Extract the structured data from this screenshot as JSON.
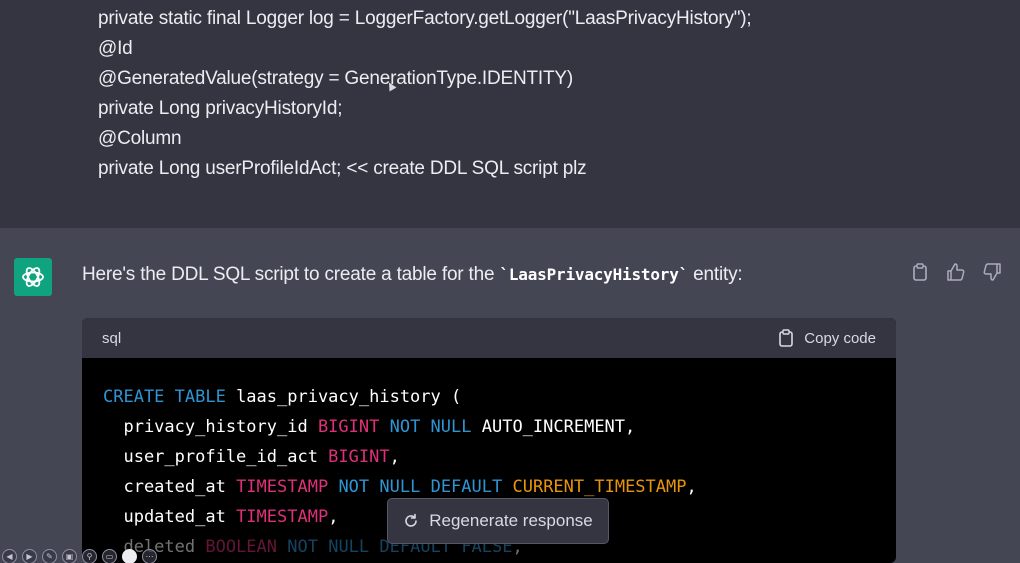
{
  "user_message": {
    "lines": [
      "private static final Logger log = LoggerFactory.getLogger(\"LaasPrivacyHistory\");",
      "@Id",
      "@GeneratedValue(strategy = GenerationType.IDENTITY)",
      "private Long privacyHistoryId;",
      "@Column",
      "private Long userProfileIdAct; << create DDL SQL script plz"
    ]
  },
  "assistant": {
    "avatar_icon": "openai-logo-icon",
    "reply_prefix": "Here's the DDL SQL script to create a table for the ",
    "reply_code": "`LaasPrivacyHistory`",
    "reply_suffix": " entity:",
    "actions": [
      "clipboard-icon",
      "thumbs-up-icon",
      "thumbs-down-icon"
    ]
  },
  "code_block": {
    "language": "sql",
    "copy_label": "Copy code",
    "lines": [
      [
        {
          "t": "CREATE TABLE",
          "c": "kw"
        },
        {
          "t": " laas_privacy_history (",
          "c": ""
        }
      ],
      [
        {
          "t": "  privacy_history_id ",
          "c": ""
        },
        {
          "t": "BIGINT",
          "c": "ty"
        },
        {
          "t": " ",
          "c": ""
        },
        {
          "t": "NOT NULL",
          "c": "kw"
        },
        {
          "t": " AUTO_INCREMENT,",
          "c": ""
        }
      ],
      [
        {
          "t": "  user_profile_id_act ",
          "c": ""
        },
        {
          "t": "BIGINT",
          "c": "ty"
        },
        {
          "t": ",",
          "c": ""
        }
      ],
      [
        {
          "t": "  created_at ",
          "c": ""
        },
        {
          "t": "TIMESTAMP",
          "c": "ty"
        },
        {
          "t": " ",
          "c": ""
        },
        {
          "t": "NOT NULL",
          "c": "kw"
        },
        {
          "t": " ",
          "c": ""
        },
        {
          "t": "DEFAULT",
          "c": "kw"
        },
        {
          "t": " ",
          "c": ""
        },
        {
          "t": "CURRENT_TIMESTAMP",
          "c": "fn"
        },
        {
          "t": ",",
          "c": ""
        }
      ],
      [
        {
          "t": "  updated_at ",
          "c": ""
        },
        {
          "t": "TIMESTAMP",
          "c": "ty"
        },
        {
          "t": ",",
          "c": ""
        }
      ],
      [
        {
          "t": "  deleted ",
          "c": ""
        },
        {
          "t": "BOOLEAN",
          "c": "ty"
        },
        {
          "t": " ",
          "c": ""
        },
        {
          "t": "NOT NULL",
          "c": "kw"
        },
        {
          "t": " ",
          "c": ""
        },
        {
          "t": "DEFAULT",
          "c": "kw"
        },
        {
          "t": " ",
          "c": ""
        },
        {
          "t": "FALSE",
          "c": "kw"
        },
        {
          "t": ",",
          "c": ""
        }
      ]
    ]
  },
  "regenerate": {
    "label": "Regenerate response",
    "icon": "refresh-icon"
  },
  "player_controls": [
    "prev-icon",
    "next-icon",
    "pen-icon",
    "copy-slide-icon",
    "zoom-icon",
    "screen-icon",
    "pointer-icon",
    "more-icon"
  ],
  "colors": {
    "user_bg": "#343541",
    "assistant_bg": "#444654",
    "avatar": "#10a37f",
    "keyword": "#2e95d3",
    "type": "#df3079",
    "function": "#e9950c"
  }
}
